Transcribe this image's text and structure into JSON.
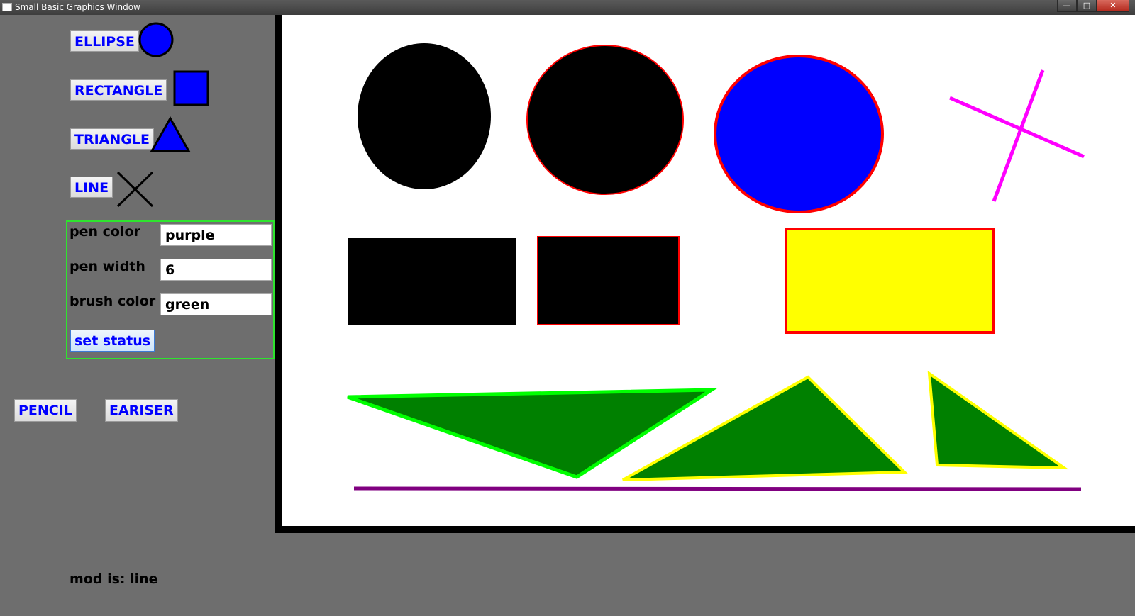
{
  "window": {
    "title": "Small Basic Graphics Window",
    "controls": {
      "minimize": "—",
      "maximize": "□",
      "close": "✕"
    }
  },
  "tools": {
    "ellipse_label": "ELLIPSE",
    "rectangle_label": "RECTANGLE",
    "triangle_label": "TRIANGLE",
    "line_label": "LINE",
    "pencil_label": "PENCIL",
    "eraser_label": "EARISER"
  },
  "settings": {
    "pen_color_label": "pen color",
    "pen_color_value": "purple",
    "pen_width_label": "pen width",
    "pen_width_value": "6",
    "brush_color_label": "brush color",
    "brush_color_value": "green",
    "set_status_label": "set status"
  },
  "status": {
    "mode_text": "mod is: line"
  },
  "colors": {
    "button_text": "#0000ff",
    "panel_bg": "#6e6e6e",
    "settings_border": "#2ee42e",
    "canvas_bg": "#ffffff",
    "icon_fill": "#0000ff"
  },
  "icons": {
    "ellipse": "circle-icon",
    "rectangle": "square-icon",
    "triangle": "triangle-icon",
    "line": "cross-line-icon"
  },
  "canvas_shapes": [
    {
      "type": "ellipse",
      "fill": "black",
      "stroke": "none"
    },
    {
      "type": "ellipse",
      "fill": "black",
      "stroke": "red"
    },
    {
      "type": "ellipse",
      "fill": "blue",
      "stroke": "red"
    },
    {
      "type": "line",
      "stroke": "magenta"
    },
    {
      "type": "line",
      "stroke": "magenta"
    },
    {
      "type": "rectangle",
      "fill": "black",
      "stroke": "none"
    },
    {
      "type": "rectangle",
      "fill": "black",
      "stroke": "red"
    },
    {
      "type": "rectangle",
      "fill": "yellow",
      "stroke": "red"
    },
    {
      "type": "triangle",
      "fill": "green",
      "stroke": "lime"
    },
    {
      "type": "triangle",
      "fill": "green",
      "stroke": "yellow"
    },
    {
      "type": "triangle",
      "fill": "green",
      "stroke": "yellow"
    },
    {
      "type": "line",
      "stroke": "purple"
    }
  ]
}
